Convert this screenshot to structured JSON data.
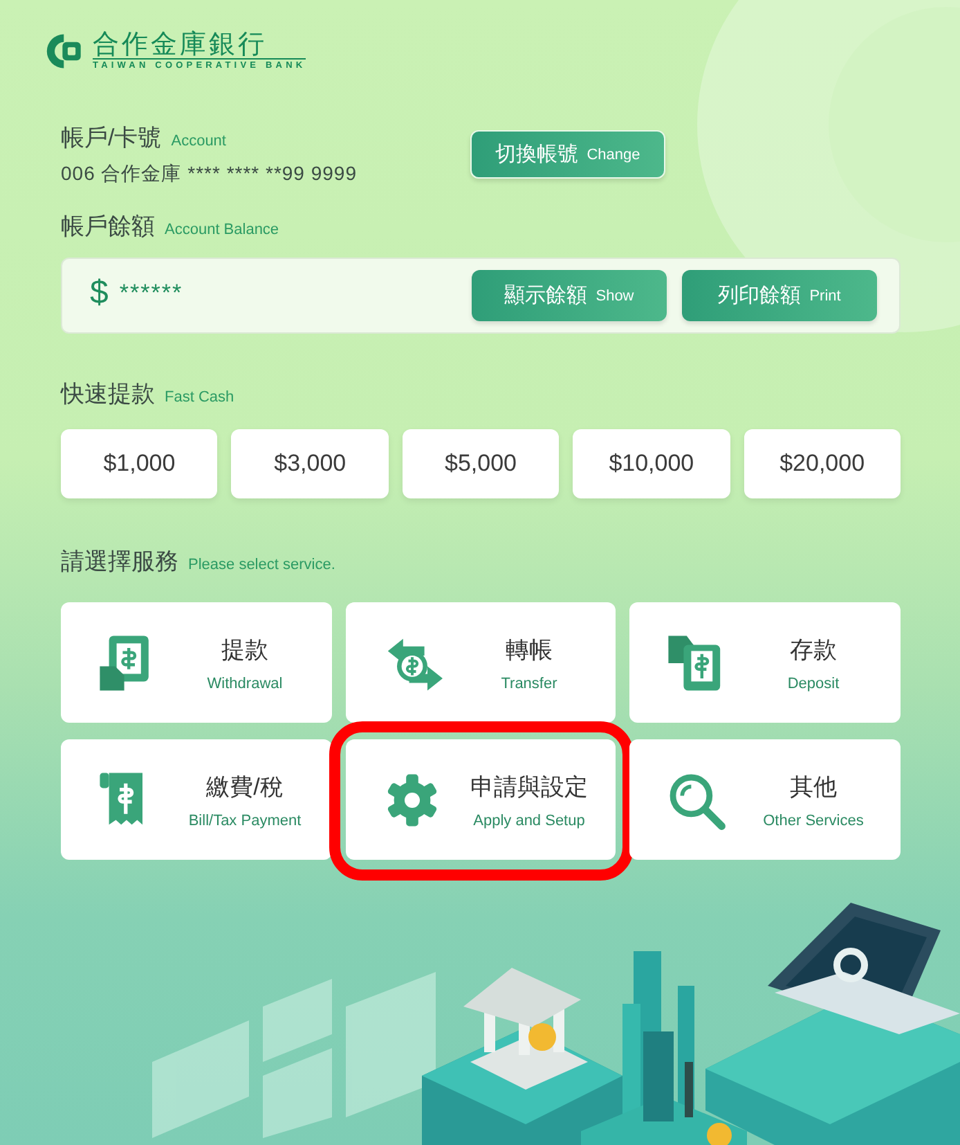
{
  "logo": {
    "name": "合作金庫銀行",
    "subtitle": "TAIWAN COOPERATIVE BANK"
  },
  "account": {
    "label": "帳戶/卡號",
    "label_en": "Account",
    "number": "006 合作金庫 **** **** **99 9999",
    "button": {
      "label": "切換帳號",
      "label_en": "Change"
    }
  },
  "balance": {
    "label": "帳戶餘額",
    "label_en": "Account Balance",
    "currency": "$",
    "value": "******",
    "buttons": [
      {
        "label": "顯示餘額",
        "label_en": "Show"
      },
      {
        "label": "列印餘額",
        "label_en": "Print"
      }
    ]
  },
  "fast_cash": {
    "label": "快速提款",
    "label_en": "Fast Cash",
    "amounts": [
      "$1,000",
      "$3,000",
      "$5,000",
      "$10,000",
      "$20,000"
    ]
  },
  "services": {
    "label": "請選擇服務",
    "label_en": "Please select service.",
    "items": [
      {
        "kind": "withdrawal",
        "label": "提款",
        "label_en": "Withdrawal",
        "highlighted": false
      },
      {
        "kind": "transfer",
        "label": "轉帳",
        "label_en": "Transfer",
        "highlighted": false
      },
      {
        "kind": "deposit",
        "label": "存款",
        "label_en": "Deposit",
        "highlighted": false
      },
      {
        "kind": "bill",
        "label": "繳費/稅",
        "label_en": "Bill/Tax Payment",
        "highlighted": false
      },
      {
        "kind": "settings",
        "label": "申請與設定",
        "label_en": "Apply and Setup",
        "highlighted": true
      },
      {
        "kind": "search",
        "label": "其他",
        "label_en": "Other Services",
        "highlighted": false
      }
    ]
  }
}
